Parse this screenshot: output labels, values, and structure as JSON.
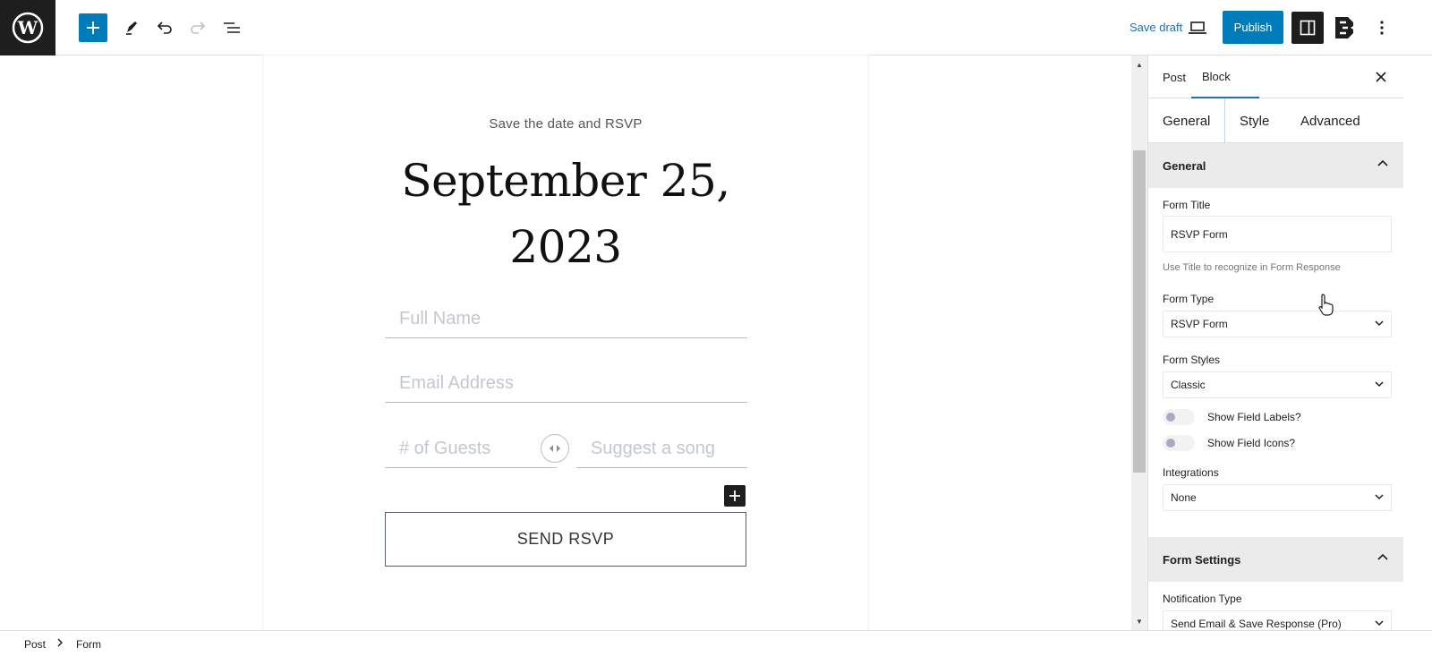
{
  "toolbar": {
    "save_draft": "Save draft",
    "publish": "Publish",
    "icons": [
      "wordpress-logo",
      "plus-icon",
      "pen-icon",
      "undo-icon",
      "redo-icon",
      "list-view-icon",
      "laptop-icon",
      "sidebar-icon",
      "plugin-logo",
      "more-vertical-icon"
    ]
  },
  "canvas": {
    "pre_title": "Save the date and RSVP",
    "date_line1": "September 25,",
    "date_line2": "2023",
    "fields": {
      "full_name": "Full Name",
      "email": "Email Address",
      "guests": "# of Guests",
      "song": "Suggest a song"
    },
    "submit": "SEND RSVP"
  },
  "sidebar": {
    "tabs": [
      "Post",
      "Block"
    ],
    "subtabs": [
      "General",
      "Style",
      "Advanced"
    ],
    "general": {
      "heading": "General",
      "form_title_label": "Form Title",
      "form_title_value": "RSVP Form",
      "form_title_help": "Use Title to recognize in Form Response",
      "form_type_label": "Form Type",
      "form_type_value": "RSVP Form",
      "form_styles_label": "Form Styles",
      "form_styles_value": "Classic",
      "show_labels": "Show Field Labels?",
      "show_icons": "Show Field Icons?",
      "integrations_label": "Integrations",
      "integrations_value": "None"
    },
    "form_settings": {
      "heading": "Form Settings",
      "notification_label": "Notification Type",
      "notification_value": "Send Email & Save Response (Pro)"
    }
  },
  "footer": {
    "crumbs": [
      "Post",
      "Form"
    ]
  },
  "colors": {
    "accent": "#007cba",
    "dark": "#1e1e1e"
  }
}
